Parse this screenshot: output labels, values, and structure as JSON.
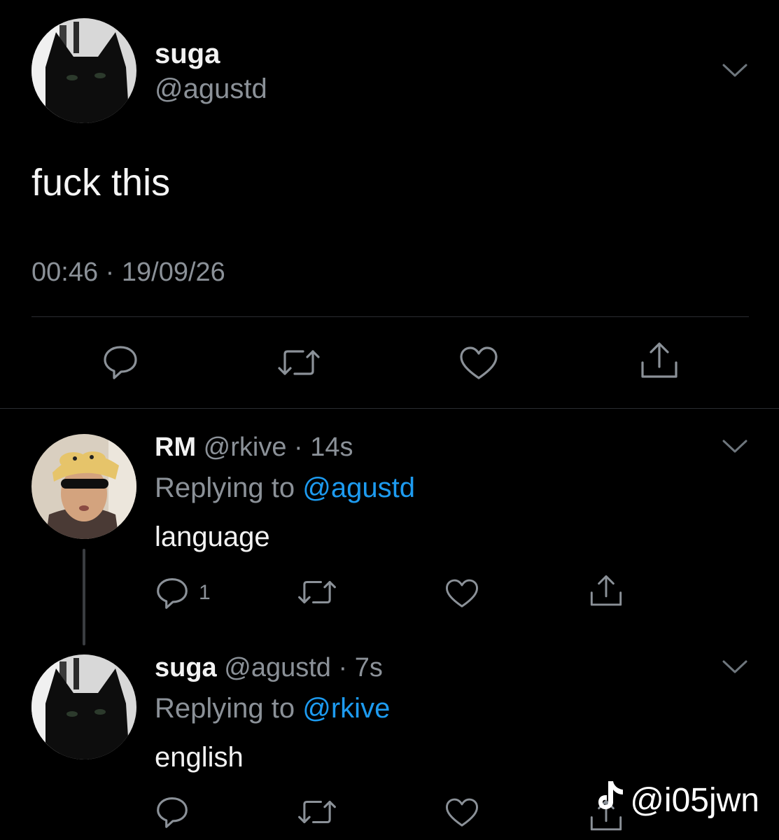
{
  "main_tweet": {
    "display_name": "suga",
    "handle": "@agustd",
    "text": "fuck this",
    "timestamp": "00:46 · 19/09/26",
    "avatar": "black-cat-avatar"
  },
  "replies": [
    {
      "display_name": "RM",
      "handle": "@rkive",
      "age": "· 14s",
      "replying_prefix": "Replying to",
      "replying_to": "@agustd",
      "text": "language",
      "reply_count": "1",
      "avatar": "person-with-duck-hat-avatar"
    },
    {
      "display_name": "suga",
      "handle": "@agustd",
      "age": "· 7s",
      "replying_prefix": "Replying to",
      "replying_to": "@rkive",
      "text": "english",
      "avatar": "black-cat-avatar"
    }
  ],
  "icons": {
    "reply": "speech-bubble-icon",
    "retweet": "retweet-arrows-icon",
    "like": "heart-icon",
    "share": "share-upload-icon",
    "more": "chevron-down-icon"
  },
  "watermark": {
    "logo": "tiktok-logo",
    "text": "@i05jwn"
  },
  "colors": {
    "background": "#000000",
    "text": "#f2f2f2",
    "secondary": "#8b9198",
    "accent": "#1d9bf0",
    "divider": "#2a2d31"
  }
}
